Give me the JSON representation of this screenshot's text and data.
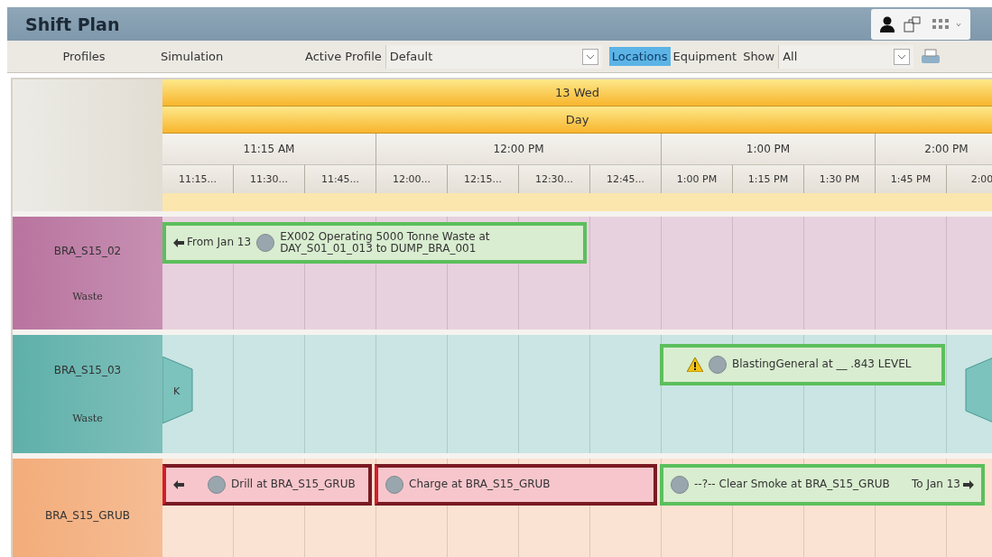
{
  "window": {
    "title": "Shift Plan"
  },
  "toolbar": {
    "profiles": "Profiles",
    "simulation": "Simulation",
    "active_profile_label": "Active Profile",
    "active_profile": "Default",
    "view_toggle": [
      {
        "label": "Locations",
        "selected": true
      },
      {
        "label": "Equipment",
        "selected": false
      }
    ],
    "show_label": "Show",
    "show": "All"
  },
  "timeline": {
    "date": "13 Wed",
    "shift": "Day",
    "hours": [
      "11:15 AM",
      "12:00 PM",
      "1:00 PM",
      "2:00 PM"
    ],
    "slots": [
      "11:15...",
      "11:30...",
      "11:45...",
      "12:00...",
      "12:15...",
      "12:30...",
      "12:45...",
      "1:00 PM",
      "1:15 PM",
      "1:30 PM",
      "1:45 PM",
      "2:00"
    ]
  },
  "rows": [
    {
      "name": "BRA_S15_02",
      "type": "Waste",
      "color": "#b9749f",
      "events": [
        {
          "kind": "ok",
          "from": "From Jan 13",
          "text": "EX002 Operating 5000 Tonne Waste at DAY_S01_01_013 to DUMP_BRA_001"
        }
      ]
    },
    {
      "name": "BRA_S15_03",
      "type": "Waste",
      "color": "#5fb0aa",
      "navs": [
        {
          "kind": "back",
          "label": "K"
        },
        {
          "kind": "forward"
        }
      ],
      "events": [
        {
          "kind": "ok",
          "warning": true,
          "text": "BlastingGeneral at __ .843 LEVEL"
        }
      ]
    },
    {
      "name": "BRA_S15_GRUB",
      "color": "#f3ac7a",
      "events": [
        {
          "kind": "error",
          "from_arrow": true,
          "text": "Drill at BRA_S15_GRUB"
        },
        {
          "kind": "error",
          "text": "Charge at BRA_S15_GRUB"
        },
        {
          "kind": "ok",
          "text": "--?-- Clear Smoke at BRA_S15_GRUB",
          "to": "To Jan 13"
        }
      ]
    }
  ]
}
